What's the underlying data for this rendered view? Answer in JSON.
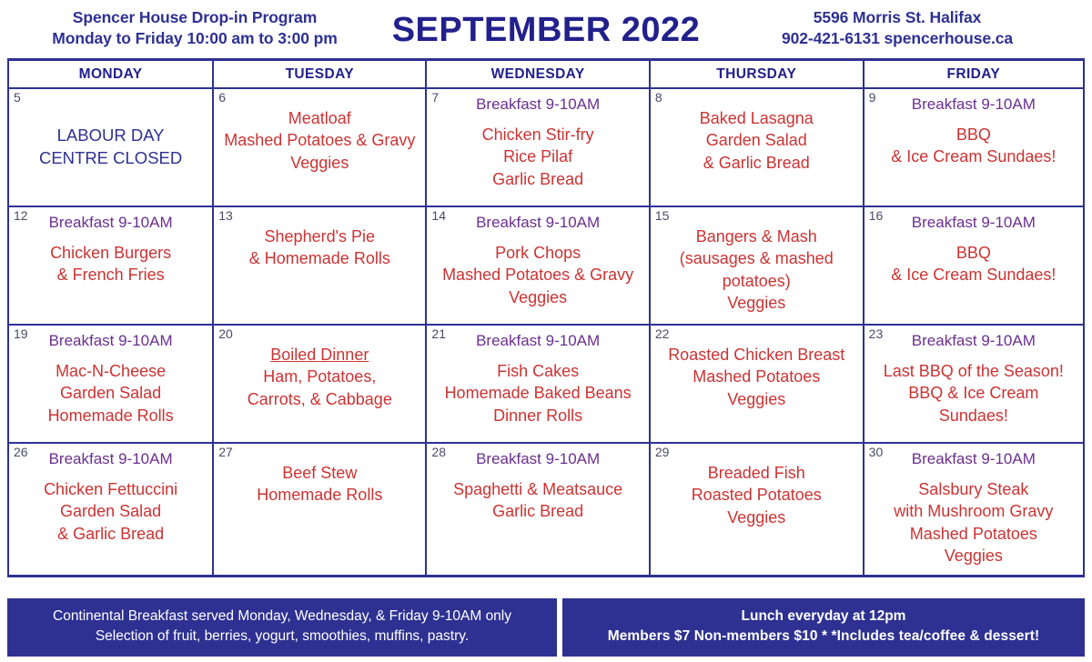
{
  "header": {
    "org_line1": "Spencer House Drop-in Program",
    "org_line2": "Monday to Friday 10:00 am to 3:00 pm",
    "month_title": "SEPTEMBER 2022",
    "address_line1": "5596 Morris St. Halifax",
    "address_line2": "902-421-6131 spencerhouse.ca"
  },
  "colors": {
    "navy": "#2e3192",
    "red": "#cc3333",
    "purple": "#6b2f8f",
    "daynum": "#4a4a66"
  },
  "day_headers": [
    "MONDAY",
    "TUESDAY",
    "WEDNESDAY",
    "THURSDAY",
    "FRIDAY"
  ],
  "weeks": [
    {
      "days": [
        {
          "num": "5",
          "breakfast": "",
          "closed": "LABOUR DAY\nCENTRE CLOSED",
          "menu": ""
        },
        {
          "num": "6",
          "breakfast": "",
          "closed": "",
          "menu": "Meatloaf\nMashed Potatoes & Gravy\nVeggies"
        },
        {
          "num": "7",
          "breakfast": "Breakfast 9-10AM",
          "closed": "",
          "menu": "Chicken Stir-fry\nRice Pilaf\nGarlic Bread"
        },
        {
          "num": "8",
          "breakfast": "",
          "closed": "",
          "menu": "Baked Lasagna\nGarden Salad\n& Garlic Bread"
        },
        {
          "num": "9",
          "breakfast": "Breakfast 9-10AM",
          "closed": "",
          "menu": "BBQ\n& Ice Cream Sundaes!"
        }
      ]
    },
    {
      "days": [
        {
          "num": "12",
          "breakfast": "Breakfast 9-10AM",
          "closed": "",
          "menu": "Chicken Burgers\n& French Fries"
        },
        {
          "num": "13",
          "breakfast": "",
          "closed": "",
          "menu": "Shepherd's Pie\n& Homemade Rolls"
        },
        {
          "num": "14",
          "breakfast": "Breakfast 9-10AM",
          "closed": "",
          "menu": "Pork Chops\nMashed Potatoes & Gravy\nVeggies"
        },
        {
          "num": "15",
          "breakfast": "",
          "closed": "",
          "menu": "Bangers & Mash\n(sausages & mashed\npotatoes)\nVeggies"
        },
        {
          "num": "16",
          "breakfast": "Breakfast 9-10AM",
          "closed": "",
          "menu": "BBQ\n& Ice Cream Sundaes!"
        }
      ]
    },
    {
      "days": [
        {
          "num": "19",
          "breakfast": "Breakfast 9-10AM",
          "closed": "",
          "menu": "Mac-N-Cheese\nGarden Salad\nHomemade Rolls"
        },
        {
          "num": "20",
          "breakfast": "",
          "closed": "",
          "menu_underline_first": true,
          "menu": "Boiled Dinner\nHam, Potatoes,\nCarrots, & Cabbage"
        },
        {
          "num": "21",
          "breakfast": "Breakfast 9-10AM",
          "closed": "",
          "menu": "Fish Cakes\nHomemade Baked Beans\nDinner Rolls"
        },
        {
          "num": "22",
          "breakfast": "",
          "closed": "",
          "menu": "Roasted Chicken Breast\nMashed Potatoes\nVeggies"
        },
        {
          "num": "23",
          "breakfast": "Breakfast 9-10AM",
          "closed": "",
          "menu": "Last BBQ of the Season!\nBBQ & Ice Cream\nSundaes!"
        }
      ]
    },
    {
      "days": [
        {
          "num": "26",
          "breakfast": "Breakfast 9-10AM",
          "closed": "",
          "menu": "Chicken Fettuccini\nGarden Salad\n& Garlic Bread"
        },
        {
          "num": "27",
          "breakfast": "",
          "closed": "",
          "menu": "Beef Stew\nHomemade Rolls"
        },
        {
          "num": "28",
          "breakfast": "Breakfast 9-10AM",
          "closed": "",
          "menu": "Spaghetti & Meatsauce\nGarlic Bread"
        },
        {
          "num": "29",
          "breakfast": "",
          "closed": "",
          "menu": "Breaded Fish\nRoasted Potatoes\nVeggies"
        },
        {
          "num": "30",
          "breakfast": "Breakfast 9-10AM",
          "closed": "",
          "menu": "Salsbury Steak\nwith Mushroom Gravy\nMashed Potatoes\nVeggies"
        }
      ]
    }
  ],
  "footer": {
    "breakfast_note_line1": "Continental Breakfast served Monday, Wednesday, & Friday 9-10AM only",
    "breakfast_note_line2": "Selection of fruit, berries, yogurt, smoothies, muffins, pastry.",
    "lunch_note_line1": "Lunch everyday at 12pm",
    "lunch_note_line2": "Members $7    Non-members $10  * *Includes tea/coffee & dessert!"
  }
}
